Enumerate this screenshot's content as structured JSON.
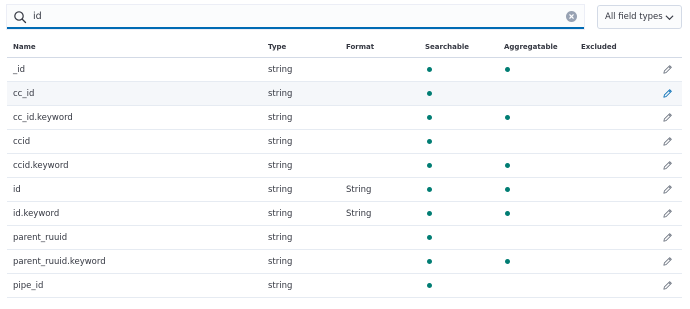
{
  "search": {
    "value": "id",
    "placeholder": ""
  },
  "filter": {
    "label": "All field types"
  },
  "columns": {
    "name": "Name",
    "type": "Type",
    "format": "Format",
    "searchable": "Searchable",
    "aggregatable": "Aggregatable",
    "excluded": "Excluded"
  },
  "rows": [
    {
      "name": "_id",
      "type": "string",
      "format": "",
      "searchable": true,
      "aggregatable": true,
      "highlighted": false
    },
    {
      "name": "cc_id",
      "type": "string",
      "format": "",
      "searchable": true,
      "aggregatable": false,
      "highlighted": true
    },
    {
      "name": "cc_id.keyword",
      "type": "string",
      "format": "",
      "searchable": true,
      "aggregatable": true,
      "highlighted": false
    },
    {
      "name": "ccid",
      "type": "string",
      "format": "",
      "searchable": true,
      "aggregatable": false,
      "highlighted": false
    },
    {
      "name": "ccid.keyword",
      "type": "string",
      "format": "",
      "searchable": true,
      "aggregatable": true,
      "highlighted": false
    },
    {
      "name": "id",
      "type": "string",
      "format": "String",
      "searchable": true,
      "aggregatable": true,
      "highlighted": false
    },
    {
      "name": "id.keyword",
      "type": "string",
      "format": "String",
      "searchable": true,
      "aggregatable": true,
      "highlighted": false
    },
    {
      "name": "parent_ruuid",
      "type": "string",
      "format": "",
      "searchable": true,
      "aggregatable": false,
      "highlighted": false
    },
    {
      "name": "parent_ruuid.keyword",
      "type": "string",
      "format": "",
      "searchable": true,
      "aggregatable": true,
      "highlighted": false
    },
    {
      "name": "pipe_id",
      "type": "string",
      "format": "",
      "searchable": true,
      "aggregatable": false,
      "highlighted": false
    }
  ],
  "colors": {
    "accent": "#006bb4",
    "dot": "#017d73",
    "border": "#d3dae6",
    "text": "#343741"
  },
  "icons": {
    "search": "search-icon",
    "clear": "clear-icon",
    "dropdown": "chevron-down-icon",
    "edit": "pencil-icon"
  }
}
